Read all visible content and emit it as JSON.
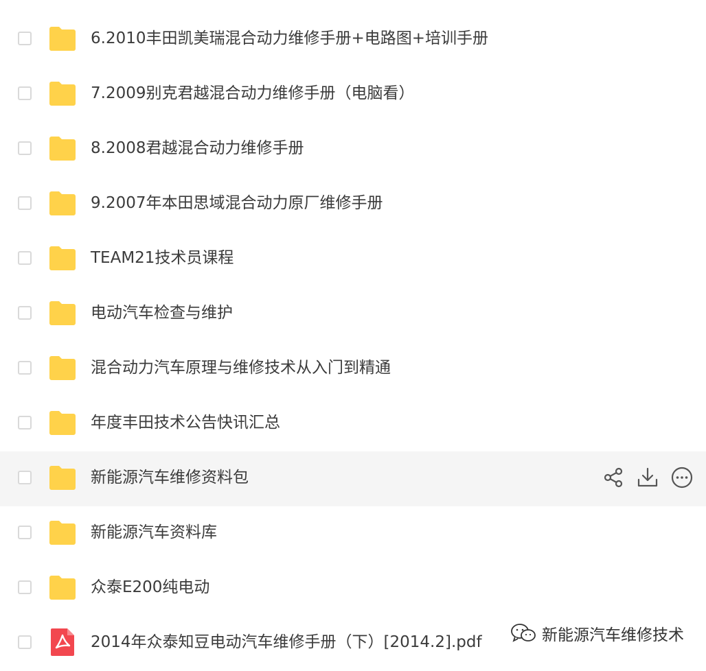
{
  "files": [
    {
      "name": "6.2010丰田凯美瑞混合动力维修手册+电路图+培训手册",
      "type": "folder"
    },
    {
      "name": "7.2009别克君越混合动力维修手册（电脑看）",
      "type": "folder"
    },
    {
      "name": "8.2008君越混合动力维修手册",
      "type": "folder"
    },
    {
      "name": "9.2007年本田思域混合动力原厂维修手册",
      "type": "folder"
    },
    {
      "name": "TEAM21技术员课程",
      "type": "folder"
    },
    {
      "name": "电动汽车检查与维护",
      "type": "folder"
    },
    {
      "name": "混合动力汽车原理与维修技术从入门到精通",
      "type": "folder"
    },
    {
      "name": "年度丰田技术公告快讯汇总",
      "type": "folder"
    },
    {
      "name": "新能源汽车维修资料包",
      "type": "folder",
      "hovered": true
    },
    {
      "name": "新能源汽车资料库",
      "type": "folder"
    },
    {
      "name": "众泰E200纯电动",
      "type": "folder"
    },
    {
      "name": "2014年众泰知豆电动汽车维修手册（下）[2014.2].pdf",
      "type": "pdf"
    }
  ],
  "row_actions": [
    "share-icon",
    "download-icon",
    "more-icon"
  ],
  "watermark": {
    "text": "新能源汽车维修技术",
    "icon": "wechat-icon"
  },
  "colors": {
    "folder": "#FFD24A",
    "pdf": "#F2474F",
    "hover_bg": "#f5f5f5",
    "icon_stroke": "#555555"
  }
}
